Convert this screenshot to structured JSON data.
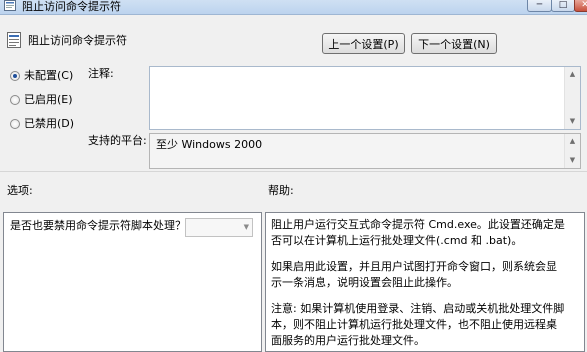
{
  "window": {
    "title": "阻止访问命令提示符",
    "min_glyph": "─",
    "max_glyph": "□",
    "close_glyph": "✕"
  },
  "header": {
    "policy_title": "阻止访问命令提示符",
    "prev_button": "上一个设置(P)",
    "next_button": "下一个设置(N)"
  },
  "state": {
    "options": [
      {
        "label": "未配置(C)",
        "checked": true
      },
      {
        "label": "已启用(E)",
        "checked": false
      },
      {
        "label": "已禁用(D)",
        "checked": false
      }
    ]
  },
  "comment": {
    "label": "注释:",
    "value": ""
  },
  "supported": {
    "label": "支持的平台:",
    "value": "至少 Windows 2000"
  },
  "sections": {
    "options_label": "选项:",
    "help_label": "帮助:"
  },
  "options_pane": {
    "question": "是否也要禁用命令提示符脚本处理？",
    "combo_value": ""
  },
  "help": {
    "paragraphs": [
      "阻止用户运行交互式命令提示符 Cmd.exe。此设置还确定是否可以在计算机上运行批处理文件(.cmd 和 .bat)。",
      "如果启用此设置，并且用户试图打开命令窗口，则系统会显示一条消息，说明设置会阻止此操作。",
      "注意: 如果计算机使用登录、注销、启动或关机批处理文件脚本，则不阻止计算机运行批处理文件，也不阻止使用远程桌面服务的用户运行批处理文件。"
    ]
  },
  "colors": {
    "selected_radio": "#1f4f9a",
    "titlebar": "#bcd3ee"
  }
}
